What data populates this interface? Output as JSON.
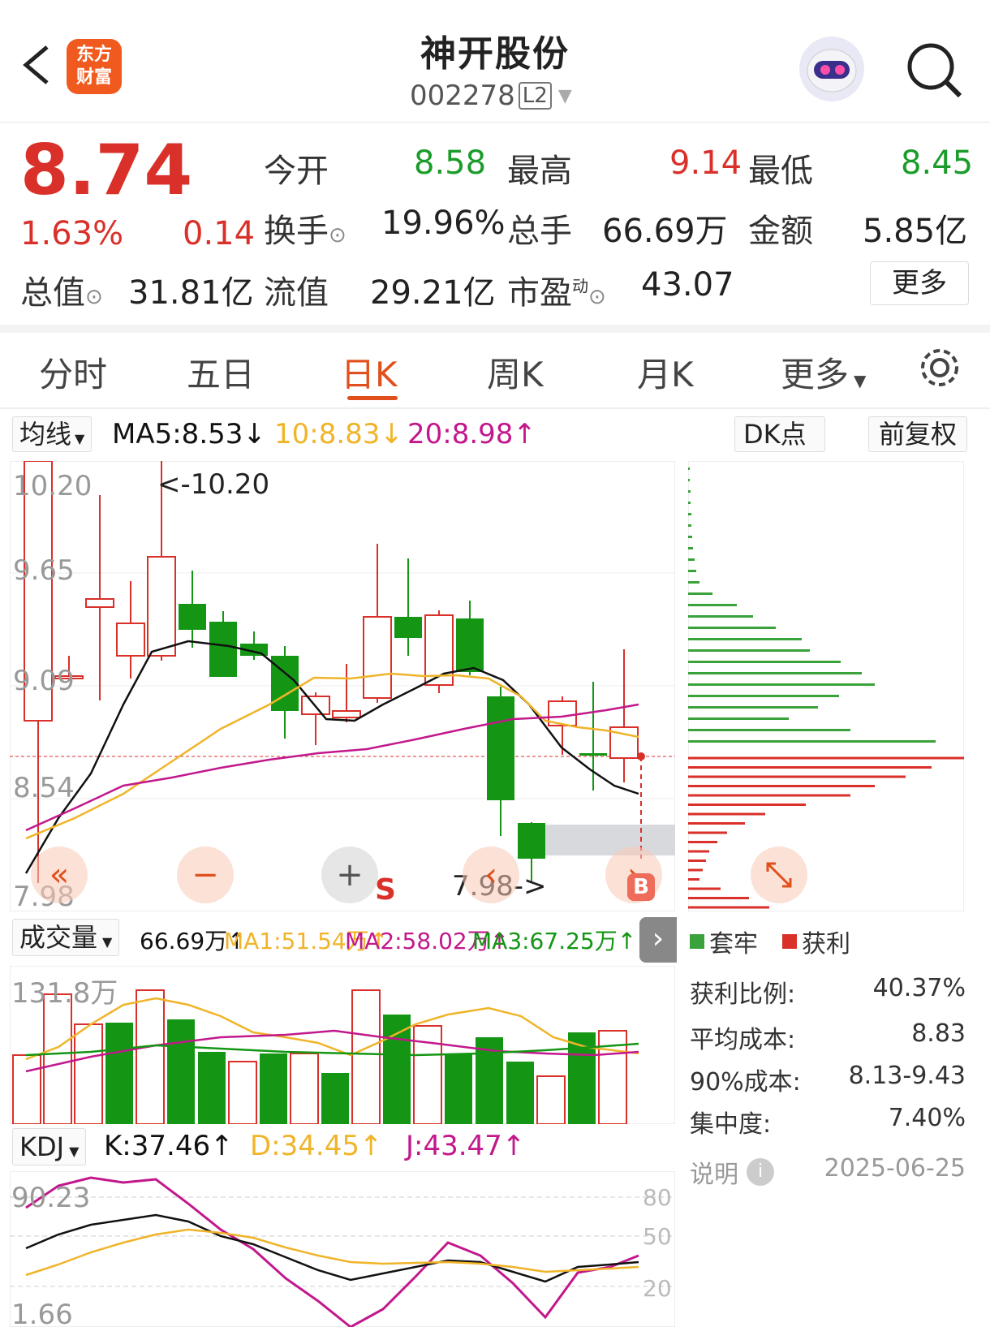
{
  "header": {
    "logo_line1": "东方",
    "logo_line2": "财富",
    "stock_name": "神开股份",
    "stock_code": "002278",
    "level": "L2"
  },
  "quote": {
    "price": "8.74",
    "change_pct": "1.63%",
    "change": "0.14",
    "open_label": "今开",
    "open": "8.58",
    "high_label": "最高",
    "high": "9.14",
    "low_label": "最低",
    "low": "8.45",
    "turnover_label": "换手",
    "turnover": "19.96%",
    "volume_label": "总手",
    "volume": "66.69万",
    "amount_label": "金额",
    "amount": "5.85亿",
    "mktcap_label": "总值",
    "mktcap": "31.81亿",
    "float_label": "流值",
    "float": "29.21亿",
    "pe_label": "市盈",
    "pe_sup": "动",
    "pe": "43.07",
    "more_btn": "更多"
  },
  "tabs": [
    "分时",
    "五日",
    "日K",
    "周K",
    "月K",
    "更多"
  ],
  "ma_bar": {
    "selector": "均线",
    "ma5": "MA5:8.53↓",
    "ma10": "10:8.83↓",
    "ma20": "20:8.98↑",
    "dk": "DK点",
    "fq": "前复权"
  },
  "kline": {
    "y_labels": [
      "10.20",
      "9.65",
      "9.09",
      "8.54",
      "7.98"
    ],
    "max_note": "<-10.20",
    "min_note": "7.98->",
    "s_mark": "S",
    "b_mark": "B"
  },
  "volume_bar": {
    "selector": "成交量",
    "vol": "66.69万↑",
    "ma1": "MA1:51.54万↑",
    "ma2": "MA2:58.02万↑",
    "ma3": "MA3:67.25万↑",
    "max_label": "131.8万"
  },
  "kdj_bar": {
    "selector": "KDJ",
    "k": "K:37.46↑",
    "d": "D:34.45↑",
    "j": "J:43.47↑",
    "top_label": "90.23",
    "bottom_label": "1.66",
    "levels": [
      "80",
      "50",
      "20"
    ]
  },
  "chip": {
    "legend_trapped": "套牢",
    "legend_profit": "获利",
    "profit_ratio_label": "获利比例:",
    "profit_ratio": "40.37%",
    "avg_cost_label": "平均成本:",
    "avg_cost": "8.83",
    "cost90_label": "90%成本:",
    "cost90": "8.13-9.43",
    "concentration_label": "集中度:",
    "concentration": "7.40%",
    "note_label": "说明",
    "date": "2025-06-25"
  },
  "colors": {
    "up": "#d9302a",
    "down": "#149614",
    "ma5": "#111111",
    "ma10": "#f0b429",
    "ma20": "#c2188c",
    "accent": "#e0501c"
  }
}
